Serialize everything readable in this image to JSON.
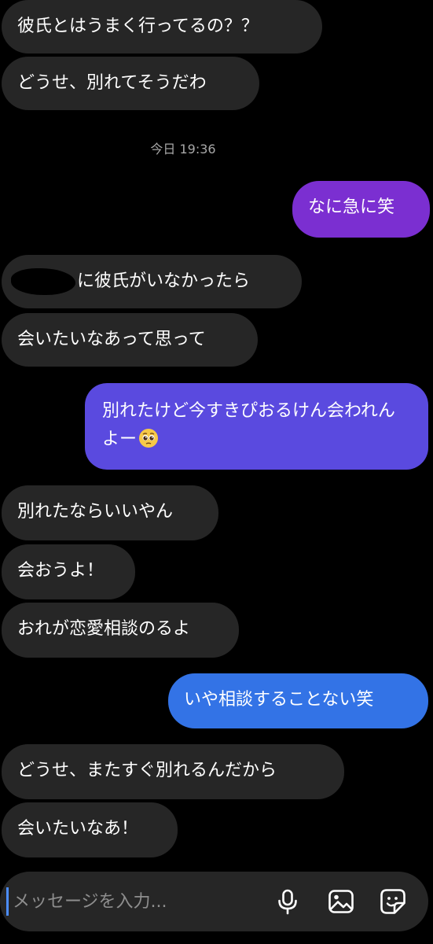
{
  "theme": {
    "background": "#000000",
    "incoming_bubble": "#262626",
    "outgoing_gradient_top": "#7a2fd0",
    "outgoing_gradient_mid": "#5b4be0",
    "outgoing_gradient_bottom": "#2f6fe8",
    "timestamp_color": "#a8a8a8"
  },
  "thread": {
    "messages": [
      {
        "direction": "incoming",
        "text": "彼氏とはうまく行ってるの？？"
      },
      {
        "direction": "incoming",
        "text": "どうせ、別れてそうだわ"
      },
      {
        "direction": "outgoing",
        "text": "なに急に笑"
      },
      {
        "direction": "incoming",
        "text": "に彼氏がいなかったら",
        "redacted_prefix": true
      },
      {
        "direction": "incoming",
        "text": "会いたいなあって思って"
      },
      {
        "direction": "outgoing",
        "text": "別れたけど今すきぴおるけん会われんよー",
        "emoji": "pleading-face"
      },
      {
        "direction": "incoming",
        "text": "別れたならいいやん"
      },
      {
        "direction": "incoming",
        "text": "会おうよ！"
      },
      {
        "direction": "incoming",
        "text": "おれが恋愛相談のるよ"
      },
      {
        "direction": "outgoing",
        "text": "いや相談することない笑"
      },
      {
        "direction": "incoming",
        "text": "どうせ、またすぐ別れるんだから"
      },
      {
        "direction": "incoming",
        "text": "会いたいなあ！"
      }
    ],
    "timestamp": "今日 19:36"
  },
  "composer": {
    "placeholder": "メッセージを入力...",
    "value": "",
    "icons": [
      "microphone-icon",
      "gallery-icon",
      "sticker-icon"
    ]
  }
}
